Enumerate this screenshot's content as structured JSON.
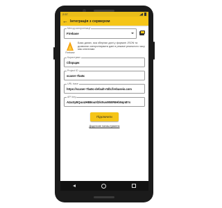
{
  "status_bar": {
    "time": "2:57"
  },
  "app_bar": {
    "title": "Інтеграція з сервером"
  },
  "method": {
    "label": "Метод синхронізації",
    "value": "Firebase",
    "icon": "database-icon"
  },
  "info": {
    "logo_name": "Firebase",
    "text": "База даних, яка зберігає дані у форматі JSON та дозволяє синхронізувати дані в режимі реального часу між клієнтами"
  },
  "fields": [
    {
      "label": "Користувач",
      "value": "Сборщик"
    },
    {
      "label": "Project ID",
      "value": "scaner-7ba5c"
    },
    {
      "label": "URL base",
      "value": "https://scaner-7ba5c-default-rtdb.firebaseio.com"
    },
    {
      "label": "API key",
      "value": "AIzaSyBQuuUHBBoaXl2kr5uvM50R6HbNqn8Ys"
    }
  ],
  "connect_button": {
    "label": "Підключити"
  },
  "settings_link": {
    "label": "Додаткові налаштування"
  },
  "colors": {
    "accent": "#f5c518",
    "status_bar": "#e9bd1a"
  }
}
